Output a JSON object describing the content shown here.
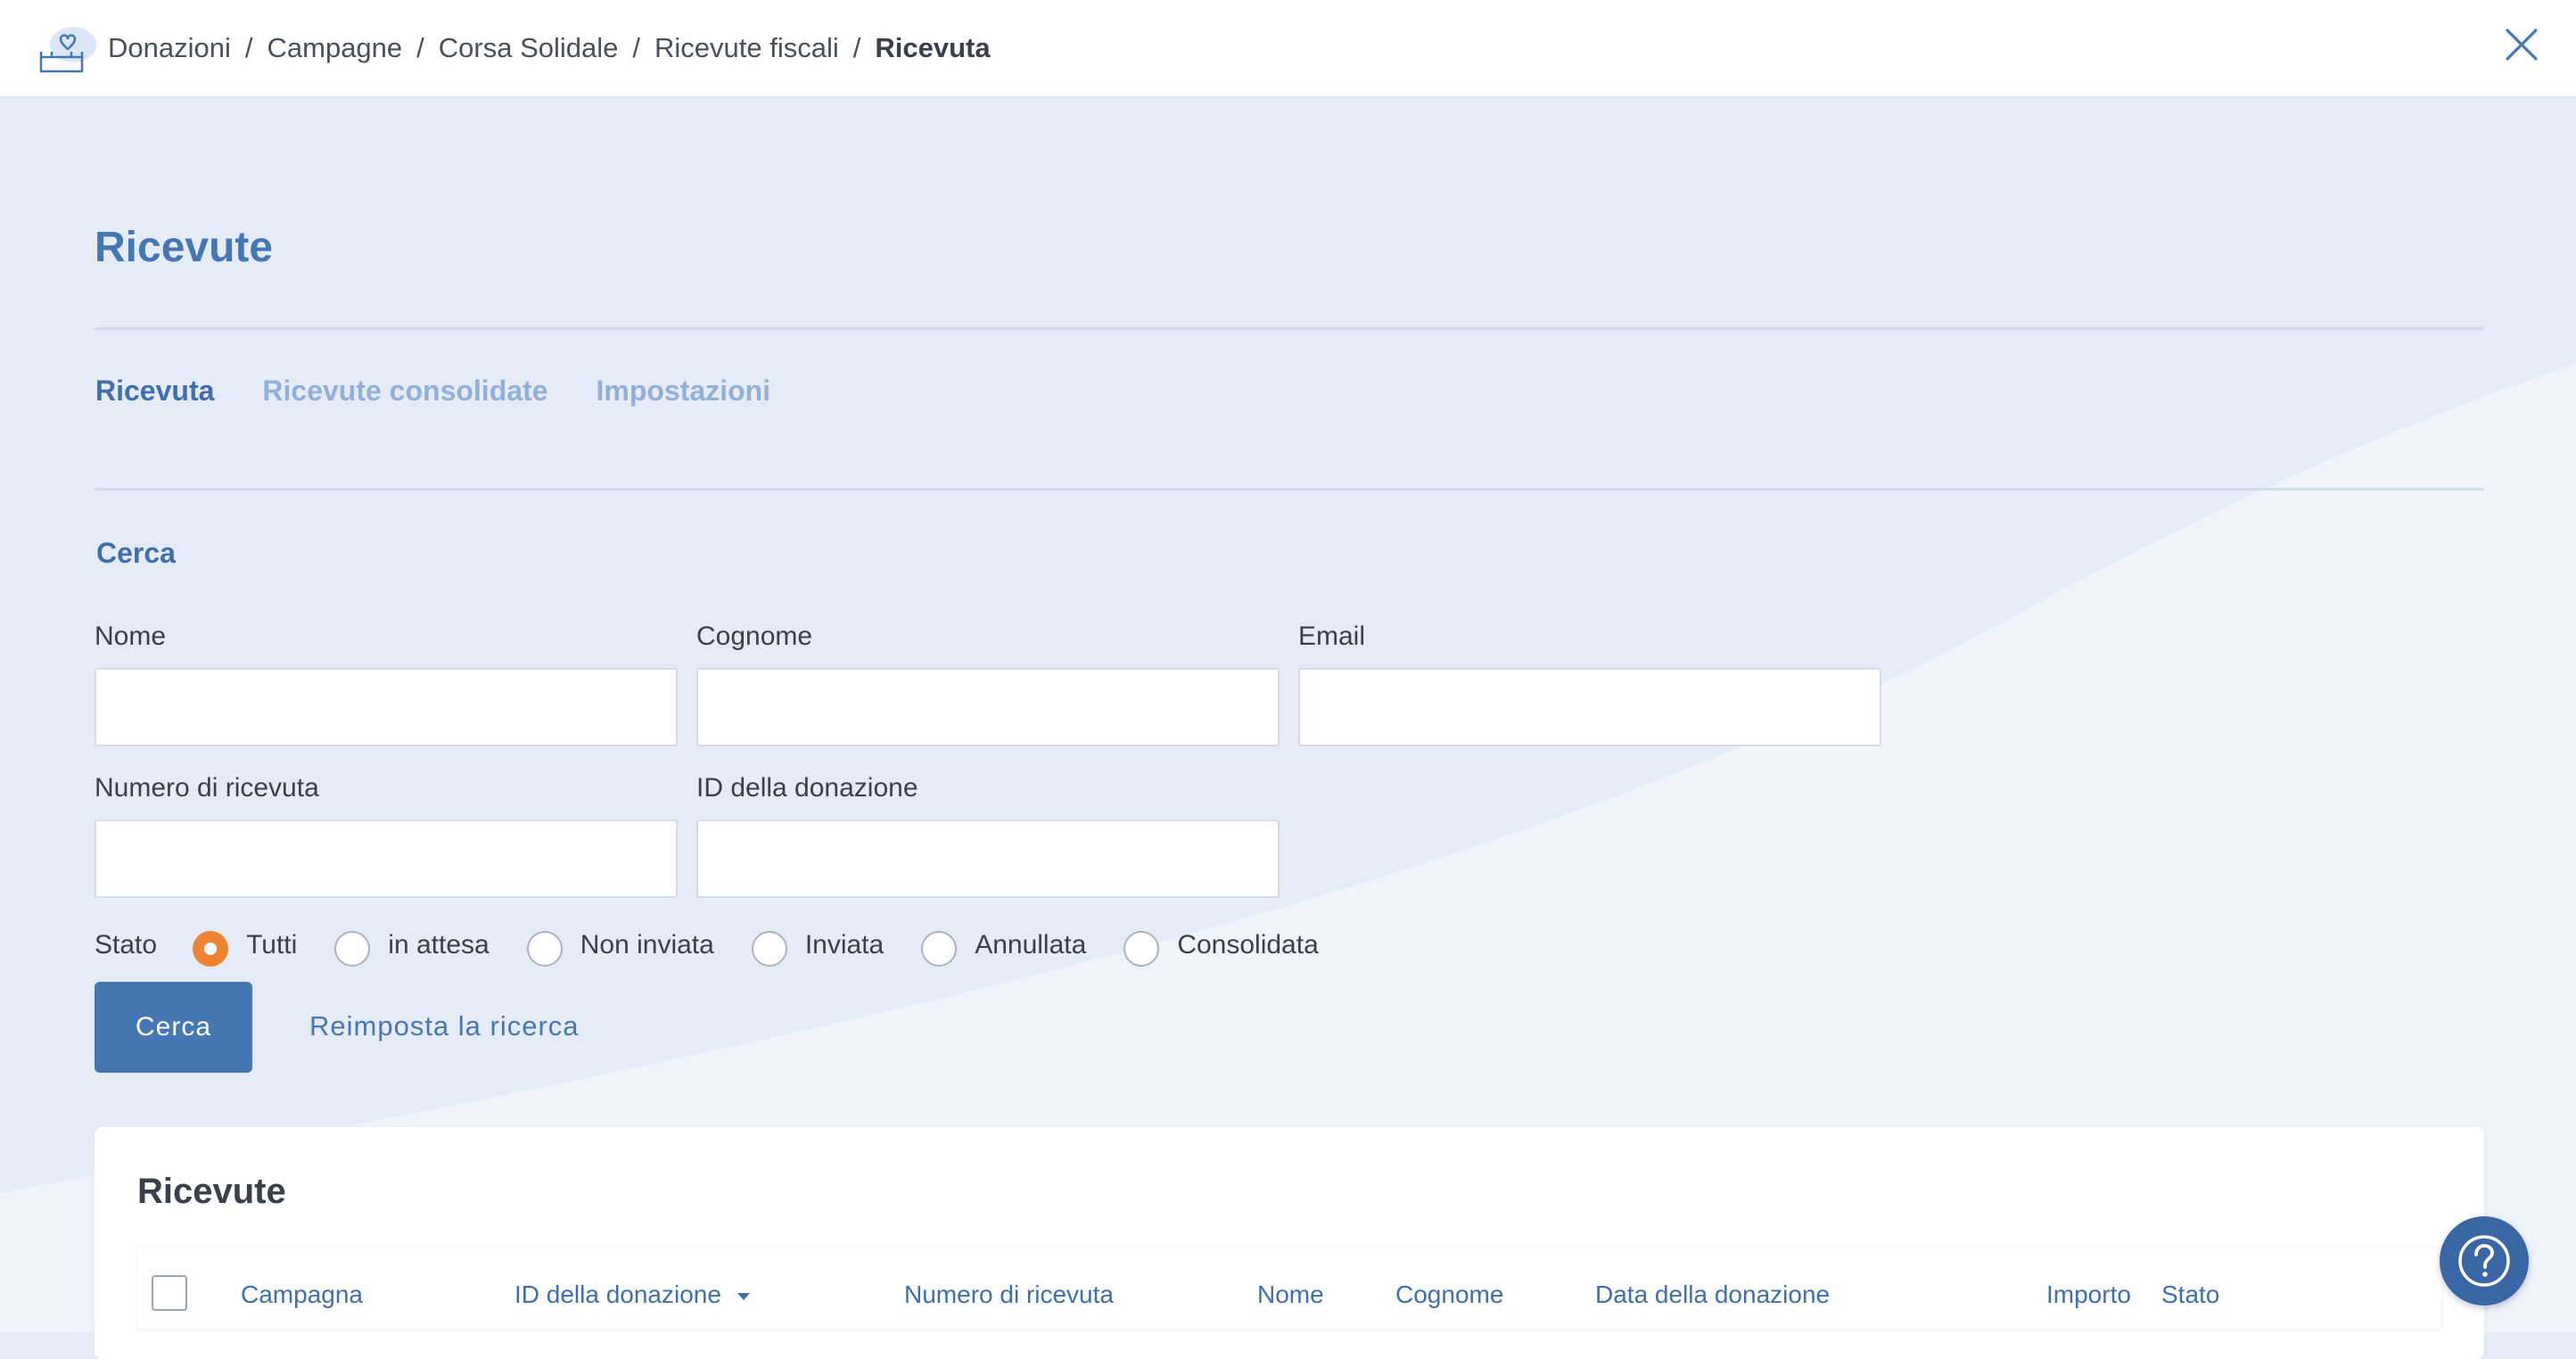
{
  "breadcrumb": {
    "items": [
      "Donazioni",
      "Campagne",
      "Corsa Solidale",
      "Ricevute fiscali"
    ],
    "current": "Ricevuta",
    "separator": "/"
  },
  "page": {
    "title": "Ricevute"
  },
  "tabs": [
    {
      "label": "Ricevuta",
      "active": true
    },
    {
      "label": "Ricevute consolidate",
      "active": false
    },
    {
      "label": "Impostazioni",
      "active": false
    }
  ],
  "search": {
    "title": "Cerca",
    "fields": {
      "nome": {
        "label": "Nome",
        "value": ""
      },
      "cognome": {
        "label": "Cognome",
        "value": ""
      },
      "email": {
        "label": "Email",
        "value": ""
      },
      "numero_ricevuta": {
        "label": "Numero di ricevuta",
        "value": ""
      },
      "id_donazione": {
        "label": "ID della donazione",
        "value": ""
      }
    },
    "status": {
      "label": "Stato",
      "options": [
        "Tutti",
        "in attesa",
        "Non inviata",
        "Inviata",
        "Annullata",
        "Consolidata"
      ],
      "selected": "Tutti"
    },
    "submit_label": "Cerca",
    "reset_label": "Reimposta la ricerca"
  },
  "results": {
    "title": "Ricevute",
    "columns": [
      "Campagna",
      "ID della donazione",
      "Numero di ricevuta",
      "Nome",
      "Cognome",
      "Data della donazione",
      "Importo",
      "Stato"
    ],
    "sorted_column": "ID della donazione"
  },
  "colors": {
    "accent": "#4577b5",
    "radio_selected": "#ee8431",
    "background": "#e6ecf7"
  },
  "icons": {
    "logo": "donation-box-heart-icon",
    "close": "close-icon",
    "help": "help-question-icon",
    "sort": "caret-down-icon"
  }
}
